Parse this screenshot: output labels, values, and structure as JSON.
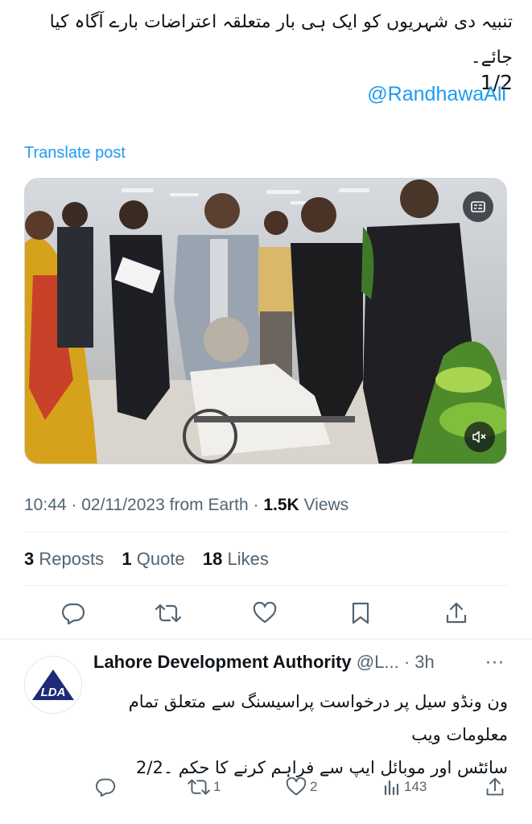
{
  "tweet": {
    "text_line1": "تنبیہ دی شہریوں کو ایک ہی بار متعلقہ اعتراضات بارے آگاہ کیا جائے۔",
    "text_page": "1/2",
    "mention": "@RandhawaAli",
    "translate_label": "Translate post",
    "meta": {
      "time": "10:44",
      "date": "02/11/2023",
      "source": "from Earth",
      "views_count": "1.5K",
      "views_label": "Views"
    },
    "stats": {
      "reposts_count": "3",
      "reposts_label": "Reposts",
      "quote_count": "1",
      "quote_label": "Quote",
      "likes_count": "18",
      "likes_label": "Likes"
    },
    "actions": [
      "reply-icon",
      "repost-icon",
      "like-icon",
      "bookmark-icon",
      "share-icon"
    ]
  },
  "reply": {
    "author_name": "Lahore Development Authority",
    "handle": "@L...",
    "time": "· 3h",
    "more": "···",
    "text_line1": "ون ونڈو سیل پر درخواست پراسیسنگ سے متعلق تمام معلومات ویب",
    "text_line2": "سائٹس اور موبائل ایپ سے فراہم کرنے کا حکم ۔2/2",
    "avatar_letters": "LDA",
    "actions": {
      "reply_count": "",
      "repost_count": "1",
      "like_count": "2",
      "views_count": "143"
    }
  },
  "colors": {
    "accent": "#1d9bf0",
    "text": "#0f1419",
    "muted": "#536471",
    "lda_blue": "#1e2a78"
  }
}
